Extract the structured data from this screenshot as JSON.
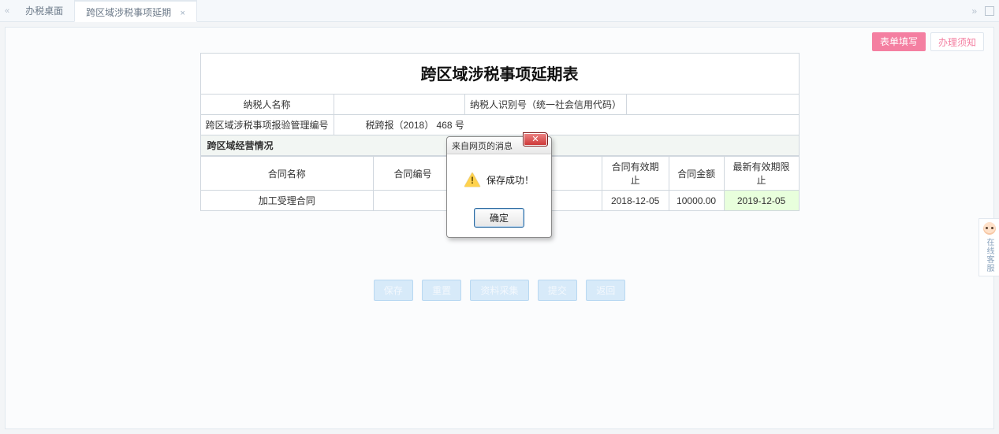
{
  "tabs": {
    "home": "办税桌面",
    "current": "跨区域涉税事项延期",
    "close_glyph": "×",
    "arrows_left": "«",
    "arrows_right": "»"
  },
  "page_tabs": {
    "primary": "表单填写",
    "secondary": "办理须知"
  },
  "form": {
    "title": "跨区域涉税事项延期表",
    "labels": {
      "taxpayer_name": "纳税人名称",
      "taxpayer_id": "纳税人识别号（统一社会信用代码）",
      "mgmt_no": "跨区域涉税事项报验管理编号",
      "section": "跨区域经营情况"
    },
    "values": {
      "taxpayer_name": "",
      "taxpayer_id": "",
      "mgmt_no": "税跨报（2018） 468 号"
    },
    "columns": {
      "contract_name": "合同名称",
      "contract_no": "合同编号",
      "spacer1": "",
      "spacer2": "",
      "valid_until": "合同有效期止",
      "amount": "合同金额",
      "new_until": "最新有效期限止"
    },
    "row": {
      "contract_name": "加工受理合同",
      "contract_no": "",
      "c3": "",
      "c4": "",
      "valid_until": "2018-12-05",
      "amount": "10000.00",
      "new_until": "2019-12-05"
    }
  },
  "buttons": {
    "b1": "保存",
    "b2": "重置",
    "b3": "资料采集",
    "b4": "提交",
    "b5": "返回"
  },
  "modal": {
    "title": "来自网页的消息",
    "message": "保存成功！",
    "ok": "确定",
    "close": "✕"
  },
  "widget": {
    "label": "在线客服"
  }
}
